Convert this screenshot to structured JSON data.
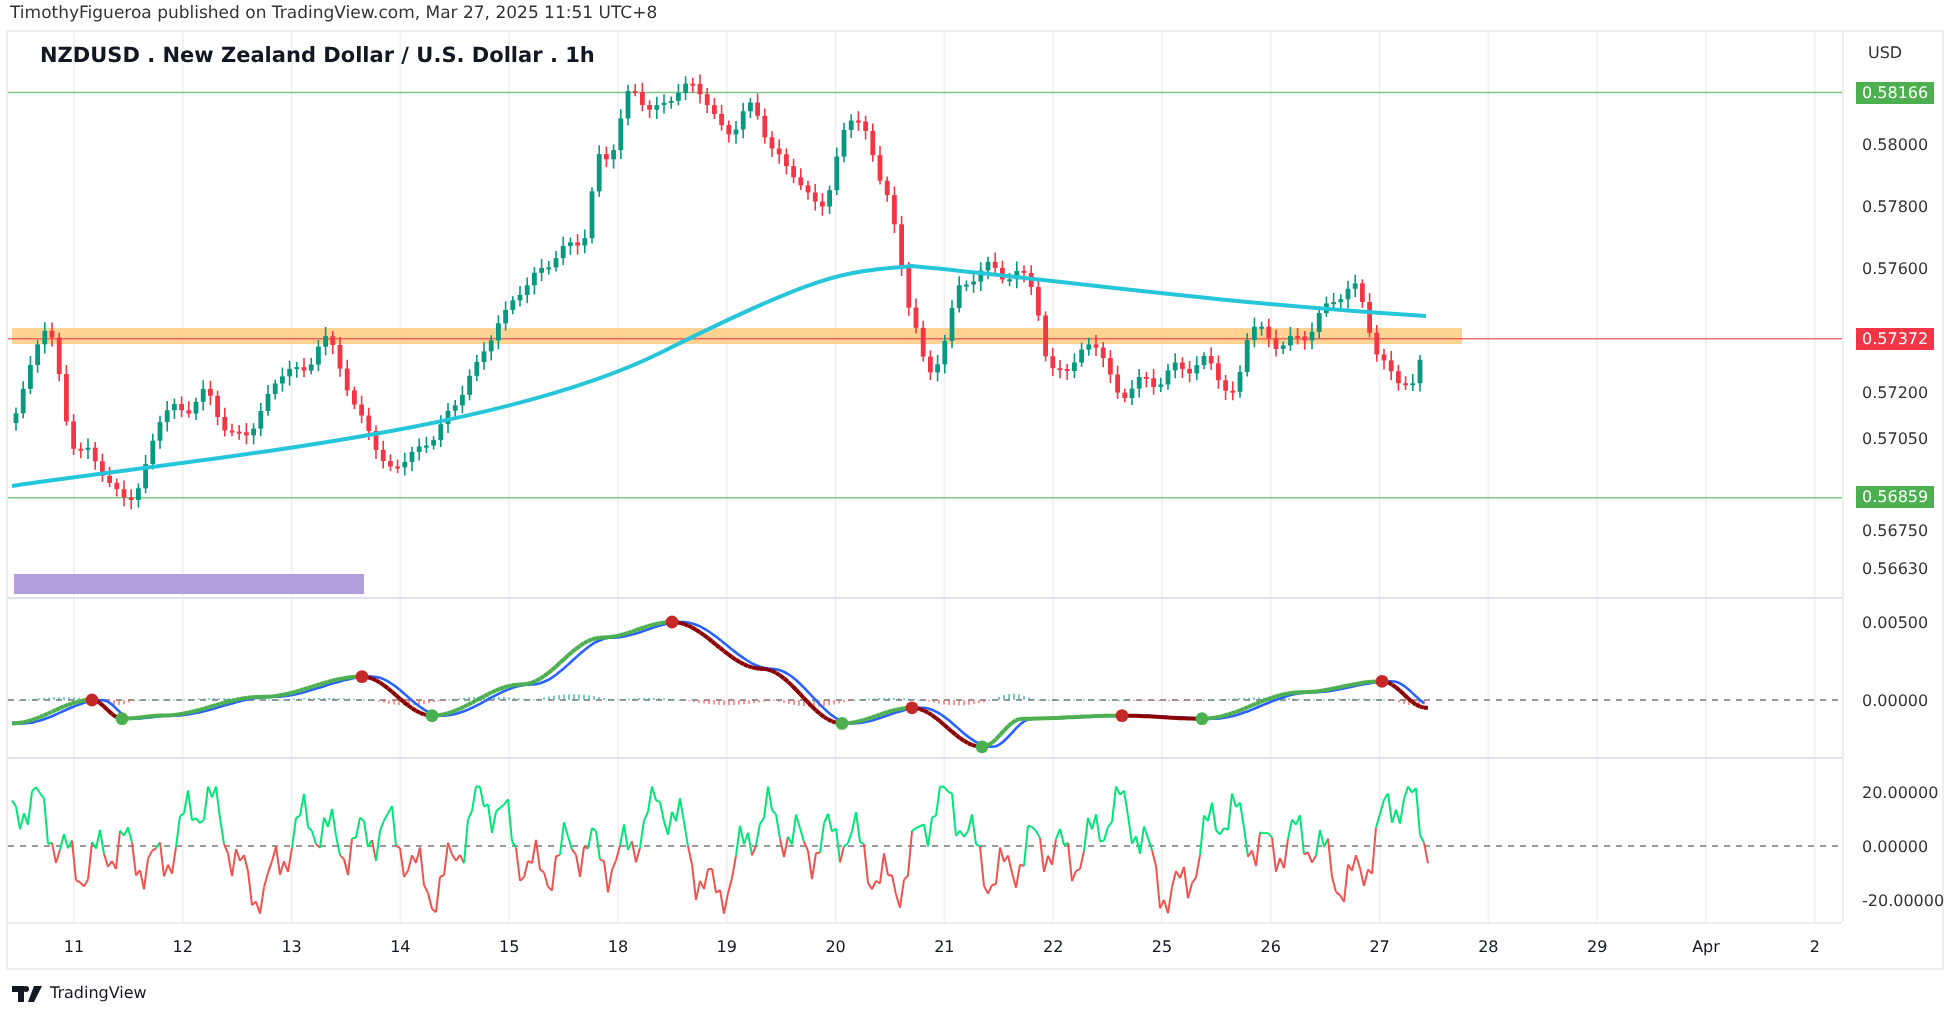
{
  "header": {
    "publisher_line": "TimothyFigueroa published on TradingView.com, Mar 27, 2025 11:51 UTC+8"
  },
  "chart": {
    "title": "NZDUSD . New Zealand Dollar / U.S. Dollar . 1h",
    "currency": "USD",
    "price_labels": [
      {
        "text": "0.58166",
        "kind": "badge",
        "color": "#4caf50"
      },
      {
        "text": "0.58000",
        "kind": "plain"
      },
      {
        "text": "0.57800",
        "kind": "plain"
      },
      {
        "text": "0.57600",
        "kind": "plain"
      },
      {
        "text": "0.57372",
        "kind": "badge",
        "color": "#f23645"
      },
      {
        "text": "0.57200",
        "kind": "plain"
      },
      {
        "text": "0.57050",
        "kind": "plain"
      },
      {
        "text": "0.56859",
        "kind": "badge",
        "color": "#4caf50"
      },
      {
        "text": "0.56750",
        "kind": "plain"
      },
      {
        "text": "0.56630",
        "kind": "plain"
      }
    ],
    "oscillator_labels": [
      "0.00500",
      "0.00000"
    ],
    "momentum_labels": [
      "20.00000",
      "0.00000",
      "-20.00000"
    ],
    "time_labels": [
      "11",
      "12",
      "13",
      "14",
      "15",
      "18",
      "19",
      "20",
      "21",
      "22",
      "25",
      "26",
      "27",
      "28",
      "29",
      "Apr",
      "2"
    ]
  },
  "footer": {
    "brand": "TradingView"
  }
}
